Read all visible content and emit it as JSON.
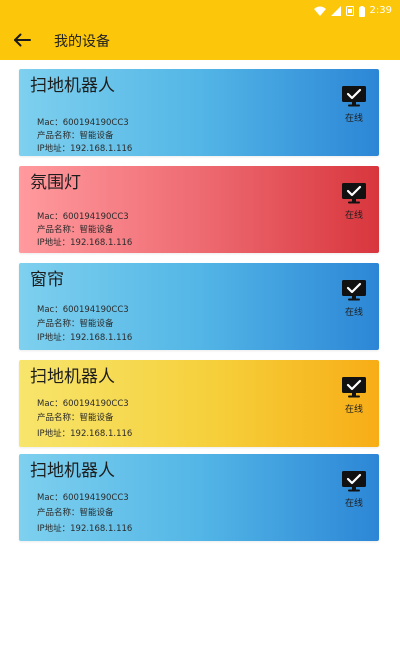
{
  "status_bar": {
    "time": "2:39",
    "icons": [
      "wifi-icon",
      "cellular-signal-icon",
      "sim-icon",
      "battery-icon"
    ]
  },
  "app_bar": {
    "title": "我的设备",
    "back_icon": "arrow-left-icon",
    "background": "#fcc70a"
  },
  "devices": [
    {
      "name": "扫地机器人",
      "mac": "Mac：600194190CC3",
      "product": "产品名称：智能设备",
      "ip": "IP地址：192.168.1.116",
      "status": "在线",
      "theme": "blue"
    },
    {
      "name": "氛围灯",
      "mac": "Mac：600194190CC3",
      "product": "产品名称：智能设备",
      "ip": "IP地址：192.168.1.116",
      "status": "在线",
      "theme": "red"
    },
    {
      "name": "窗帘",
      "mac": "Mac：600194190CC3",
      "product": "产品名称：智能设备",
      "ip": "IP地址：192.168.1.116",
      "status": "在线",
      "theme": "blue"
    },
    {
      "name": "扫地机器人",
      "mac": "Mac：600194190CC3",
      "product": "产品名称：智能设备",
      "ip": "IP地址：192.168.1.116",
      "status": "在线",
      "theme": "yellow"
    },
    {
      "name": "扫地机器人",
      "mac": "Mac：600194190CC3",
      "product": "产品名称：智能设备",
      "ip": "IP地址：192.168.1.116",
      "status": "在线",
      "theme": "blue"
    }
  ]
}
